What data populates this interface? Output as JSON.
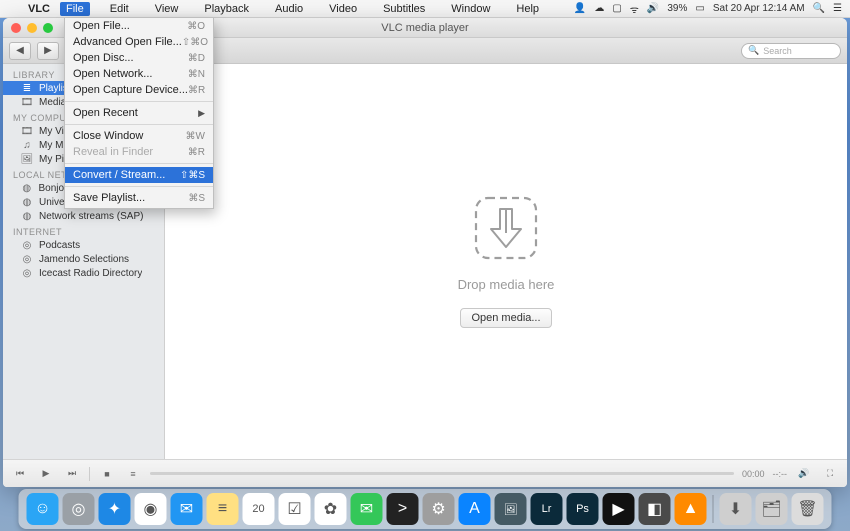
{
  "menubar": {
    "app": "VLC",
    "items": [
      "File",
      "Edit",
      "View",
      "Playback",
      "Audio",
      "Video",
      "Subtitles",
      "Window",
      "Help"
    ],
    "active_index": 0,
    "status": {
      "battery": "39%",
      "datetime": "Sat 20 Apr  12:14 AM"
    }
  },
  "dropdown": {
    "groups": [
      [
        {
          "label": "Open File...",
          "shortcut": "⌘O"
        },
        {
          "label": "Advanced Open File...",
          "shortcut": "⇧⌘O"
        },
        {
          "label": "Open Disc...",
          "shortcut": "⌘D"
        },
        {
          "label": "Open Network...",
          "shortcut": "⌘N"
        },
        {
          "label": "Open Capture Device...",
          "shortcut": "⌘R"
        }
      ],
      [
        {
          "label": "Open Recent",
          "submenu": true
        }
      ],
      [
        {
          "label": "Close Window",
          "shortcut": "⌘W"
        },
        {
          "label": "Reveal in Finder",
          "shortcut": "⌘R",
          "disabled": true
        }
      ],
      [
        {
          "label": "Convert / Stream...",
          "shortcut": "⇧⌘S",
          "selected": true
        }
      ],
      [
        {
          "label": "Save Playlist...",
          "shortcut": "⌘S"
        }
      ]
    ]
  },
  "window": {
    "title": "VLC media player",
    "search_placeholder": "Search",
    "drop_text": "Drop media here",
    "open_media": "Open media...",
    "time_elapsed": "00:00",
    "time_remaining": "--:--"
  },
  "sidebar": {
    "sections": [
      {
        "header": "LIBRARY",
        "items": [
          {
            "label": "Playlist",
            "icon": "list",
            "selected": true
          },
          {
            "label": "Media Library",
            "icon": "film"
          }
        ]
      },
      {
        "header": "MY COMPUTER",
        "items": [
          {
            "label": "My Videos",
            "icon": "film"
          },
          {
            "label": "My Music",
            "icon": "note"
          },
          {
            "label": "My Pictures",
            "icon": "image"
          }
        ]
      },
      {
        "header": "LOCAL NETWORK",
        "items": [
          {
            "label": "Bonjour Network Discovery",
            "icon": "globe"
          },
          {
            "label": "Universal Plug'n'Play",
            "icon": "globe"
          },
          {
            "label": "Network streams (SAP)",
            "icon": "globe"
          }
        ]
      },
      {
        "header": "INTERNET",
        "items": [
          {
            "label": "Podcasts",
            "icon": "rss"
          },
          {
            "label": "Jamendo Selections",
            "icon": "rss"
          },
          {
            "label": "Icecast Radio Directory",
            "icon": "rss"
          }
        ]
      }
    ]
  },
  "dock": {
    "items": [
      {
        "name": "finder",
        "bg": "#2aa5f5",
        "glyph": "☺"
      },
      {
        "name": "launchpad",
        "bg": "#9aa0a6",
        "glyph": "◎"
      },
      {
        "name": "safari",
        "bg": "#1e88e5",
        "glyph": "✦"
      },
      {
        "name": "chrome",
        "bg": "#fff",
        "glyph": "◉"
      },
      {
        "name": "mail",
        "bg": "#2196f3",
        "glyph": "✉"
      },
      {
        "name": "notes",
        "bg": "#ffe082",
        "glyph": "≡"
      },
      {
        "name": "calendar",
        "bg": "#fff",
        "glyph": "20"
      },
      {
        "name": "reminders",
        "bg": "#fff",
        "glyph": "☑"
      },
      {
        "name": "photos",
        "bg": "#fff",
        "glyph": "✿"
      },
      {
        "name": "messages",
        "bg": "#34c759",
        "glyph": "✉"
      },
      {
        "name": "terminal",
        "bg": "#222",
        "glyph": ">"
      },
      {
        "name": "settings",
        "bg": "#9e9e9e",
        "glyph": "⚙"
      },
      {
        "name": "appstore",
        "bg": "#0a84ff",
        "glyph": "A"
      },
      {
        "name": "preview",
        "bg": "#455a64",
        "glyph": "🖼"
      },
      {
        "name": "lightroom",
        "bg": "#0b2a3a",
        "glyph": "Lr"
      },
      {
        "name": "photoshop",
        "bg": "#0b2a3a",
        "glyph": "Ps"
      },
      {
        "name": "player",
        "bg": "#111",
        "glyph": "▶"
      },
      {
        "name": "sublime",
        "bg": "#4a4a4a",
        "glyph": "◧"
      },
      {
        "name": "vlc",
        "bg": "#ff8a00",
        "glyph": "▲"
      }
    ],
    "right": [
      {
        "name": "downloads",
        "bg": "#cfcfcf",
        "glyph": "⬇"
      },
      {
        "name": "docs",
        "bg": "#cfcfcf",
        "glyph": "🗂"
      },
      {
        "name": "trash",
        "bg": "#dcdcdc",
        "glyph": "🗑"
      }
    ]
  }
}
